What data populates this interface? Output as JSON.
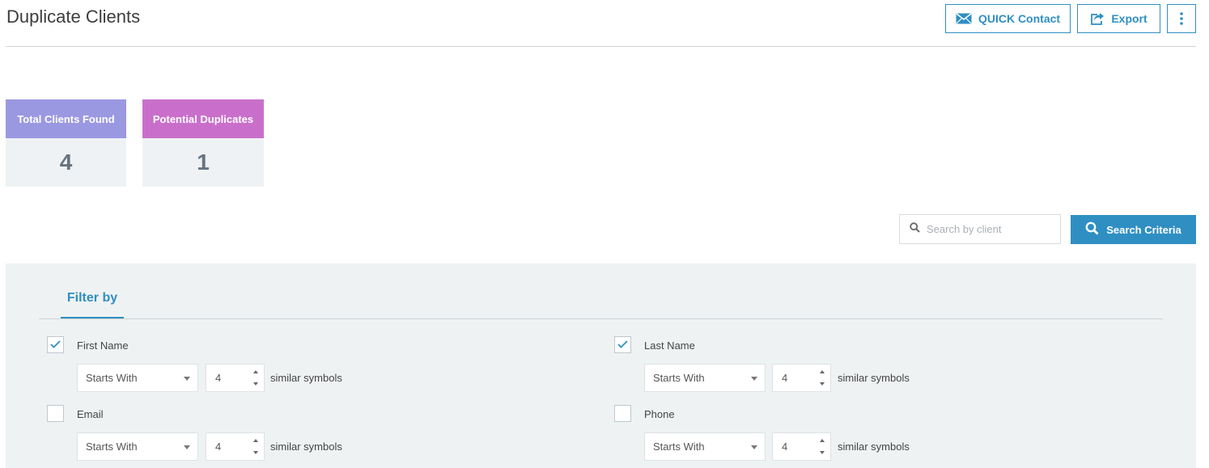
{
  "header": {
    "title": "Duplicate Clients",
    "quick_contact_label": "QUICK Contact",
    "export_label": "Export"
  },
  "stats": {
    "total": {
      "label": "Total Clients Found",
      "value": "4"
    },
    "duplicates": {
      "label": "Potential Duplicates",
      "value": "1"
    }
  },
  "search": {
    "placeholder": "Search by client",
    "button_label": "Search Criteria"
  },
  "filter": {
    "tab_label": "Filter by",
    "fields": [
      {
        "label": "First Name",
        "checked": true,
        "mode": "Starts With",
        "count": "4",
        "suffix": "similar symbols"
      },
      {
        "label": "Last Name",
        "checked": true,
        "mode": "Starts With",
        "count": "4",
        "suffix": "similar symbols"
      },
      {
        "label": "Email",
        "checked": false,
        "mode": "Starts With",
        "count": "4",
        "suffix": "similar symbols"
      },
      {
        "label": "Phone",
        "checked": false,
        "mode": "Starts With",
        "count": "4",
        "suffix": "similar symbols"
      }
    ]
  },
  "colors": {
    "accent": "#2f8fc3",
    "total_header": "#9b98e2",
    "duplicates_header": "#c96fcb",
    "panel_bg": "#eff2f3"
  }
}
